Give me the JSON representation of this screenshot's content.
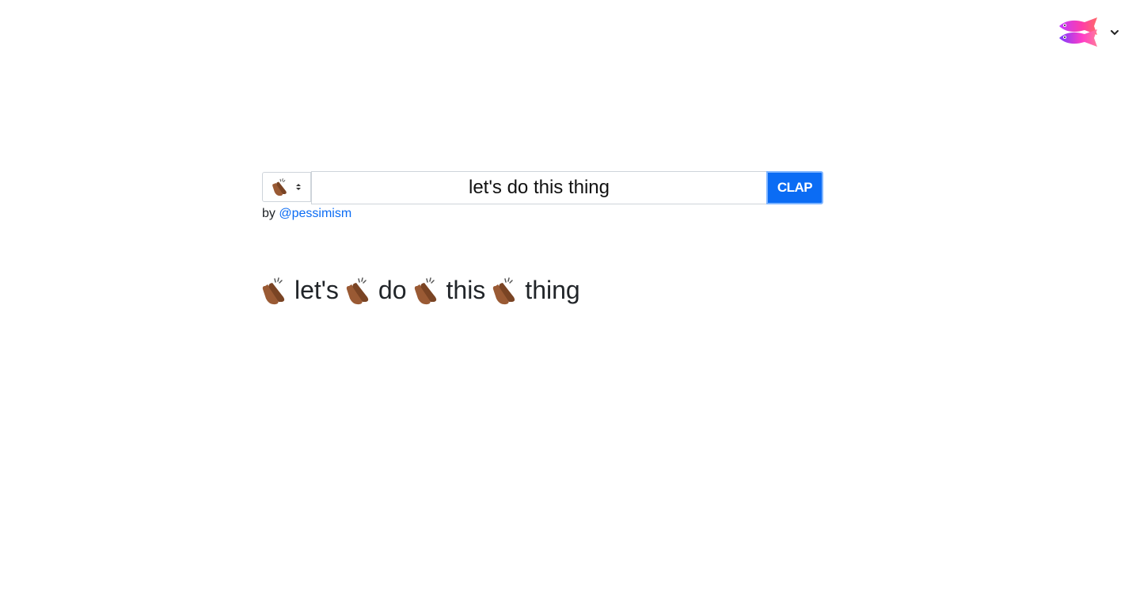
{
  "header": {
    "logo_icon": "fish-logo-icon",
    "menu_icon": "chevron-down-icon"
  },
  "form": {
    "emoji_select": {
      "selected_value": "👏🏾",
      "icon": "clapping-hands-icon"
    },
    "text_input": {
      "value": "let's do this thing"
    },
    "clap_button_label": "CLAP",
    "accent_color": "#0b6cf4"
  },
  "byline": {
    "prefix": "by",
    "author": "@pessimism"
  },
  "output": {
    "separator_icon": "clapping-hands-icon",
    "words": [
      "let's",
      "do",
      "this",
      "thing"
    ]
  }
}
